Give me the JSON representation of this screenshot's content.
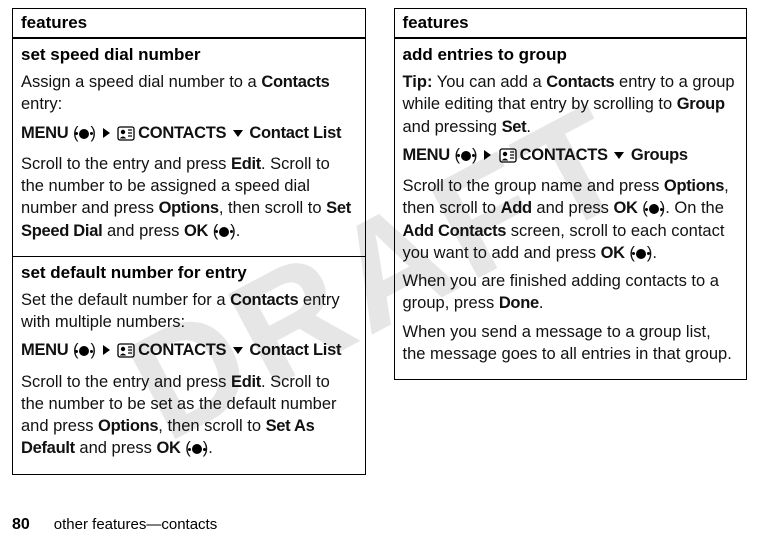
{
  "watermark": "DRAFT",
  "left": {
    "header": "features",
    "rows": [
      {
        "title": "set speed dial number",
        "p1_a": "Assign a speed dial number to a ",
        "p1_b": "Contacts",
        "p1_c": " entry:",
        "nav_menu": "MENU",
        "nav_contacts": "CONTACTS",
        "nav_last": "Contact List",
        "p2_a": "Scroll to the entry and press ",
        "p2_b": "Edit",
        "p2_c": ". Scroll to the number to be assigned a speed dial number and press ",
        "p2_d": "Options",
        "p2_e": ", then scroll to ",
        "p2_f": "Set Speed Dial",
        "p2_g": " and press ",
        "p2_h": "OK",
        "p2_i": " (",
        "p2_j": ")."
      },
      {
        "title": "set default number for entry",
        "p1_a": "Set the default number for a ",
        "p1_b": "Contacts",
        "p1_c": " entry with multiple numbers:",
        "nav_menu": "MENU",
        "nav_contacts": "CONTACTS",
        "nav_last": "Contact List",
        "p2_a": "Scroll to the entry and press ",
        "p2_b": "Edit",
        "p2_c": ". Scroll to the number to be set as the default number and press ",
        "p2_d": "Options",
        "p2_e": ", then scroll to ",
        "p2_f": "Set As Default",
        "p2_g": " and press ",
        "p2_h": "OK",
        "p2_i": " (",
        "p2_j": ")."
      }
    ]
  },
  "right": {
    "header": "features",
    "rows": [
      {
        "title": "add entries to group",
        "tip_a": "Tip:",
        "tip_b": " You can add a ",
        "tip_c": "Contacts",
        "tip_d": " entry to a group while editing that entry by scrolling to ",
        "tip_e": "Group",
        "tip_f": " and pressing ",
        "tip_g": "Set",
        "tip_h": ".",
        "nav_menu": "MENU",
        "nav_contacts": "CONTACTS",
        "nav_last": "Groups",
        "p2_a": "Scroll to the group name and press ",
        "p2_b": "Options",
        "p2_c": ", then scroll to ",
        "p2_d": "Add",
        "p2_e": " and press ",
        "p2_f": "OK",
        "p2_g": " (",
        "p2_h": "). On the ",
        "p2_i": "Add Contacts",
        "p2_j": " screen, scroll to each contact you want to add and press ",
        "p2_k": "OK",
        "p2_l": " (",
        "p2_m": ").",
        "p3_a": "When you are finished adding contacts to a group, press ",
        "p3_b": "Done",
        "p3_c": ".",
        "p4": "When you send a message to a group list, the message goes to all entries in that group."
      }
    ]
  },
  "footer": {
    "page": "80",
    "text": "other features—contacts"
  }
}
